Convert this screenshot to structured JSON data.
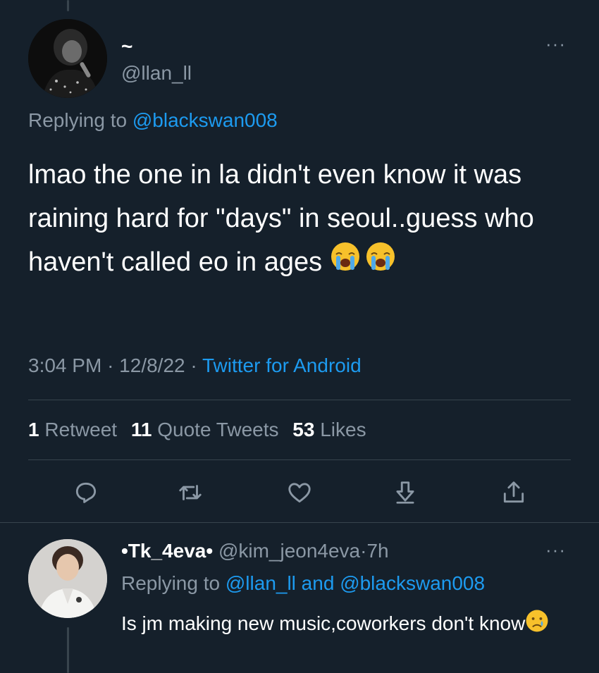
{
  "main_tweet": {
    "display_name": "~",
    "handle": "@llan_ll",
    "replying_prefix": "Replying to ",
    "replying_to": "@blackswan008",
    "text": "lmao the one in la didn't even know it was raining hard for \"days\" in seoul..guess who haven't called eo in ages",
    "emojis": [
      "loudly-crying-face",
      "loudly-crying-face"
    ],
    "time": "3:04 PM",
    "date": "12/8/22",
    "separator": "·",
    "source": "Twitter for Android",
    "stats": {
      "retweets_count": "1",
      "retweets_label": "Retweet",
      "quotes_count": "11",
      "quotes_label": "Quote Tweets",
      "likes_count": "53",
      "likes_label": "Likes"
    },
    "actions": [
      "reply-icon",
      "retweet-icon",
      "like-icon",
      "bookmark-icon",
      "share-icon"
    ]
  },
  "reply_tweet": {
    "display_name": "•Tk_4eva•",
    "handle": "@kim_jeon4eva",
    "time_ago": "7h",
    "separator": "·",
    "replying_prefix": "Replying to ",
    "replying_to_1": "@llan_ll",
    "replying_and": " and ",
    "replying_to_2": "@blackswan008",
    "text": "Is jm making new music,coworkers don't know",
    "emoji": "crying-face"
  },
  "more_label": "···",
  "colors": {
    "background": "#15202b",
    "accent": "#1d9bf0",
    "muted": "#8b98a5",
    "divider": "#38444d"
  }
}
